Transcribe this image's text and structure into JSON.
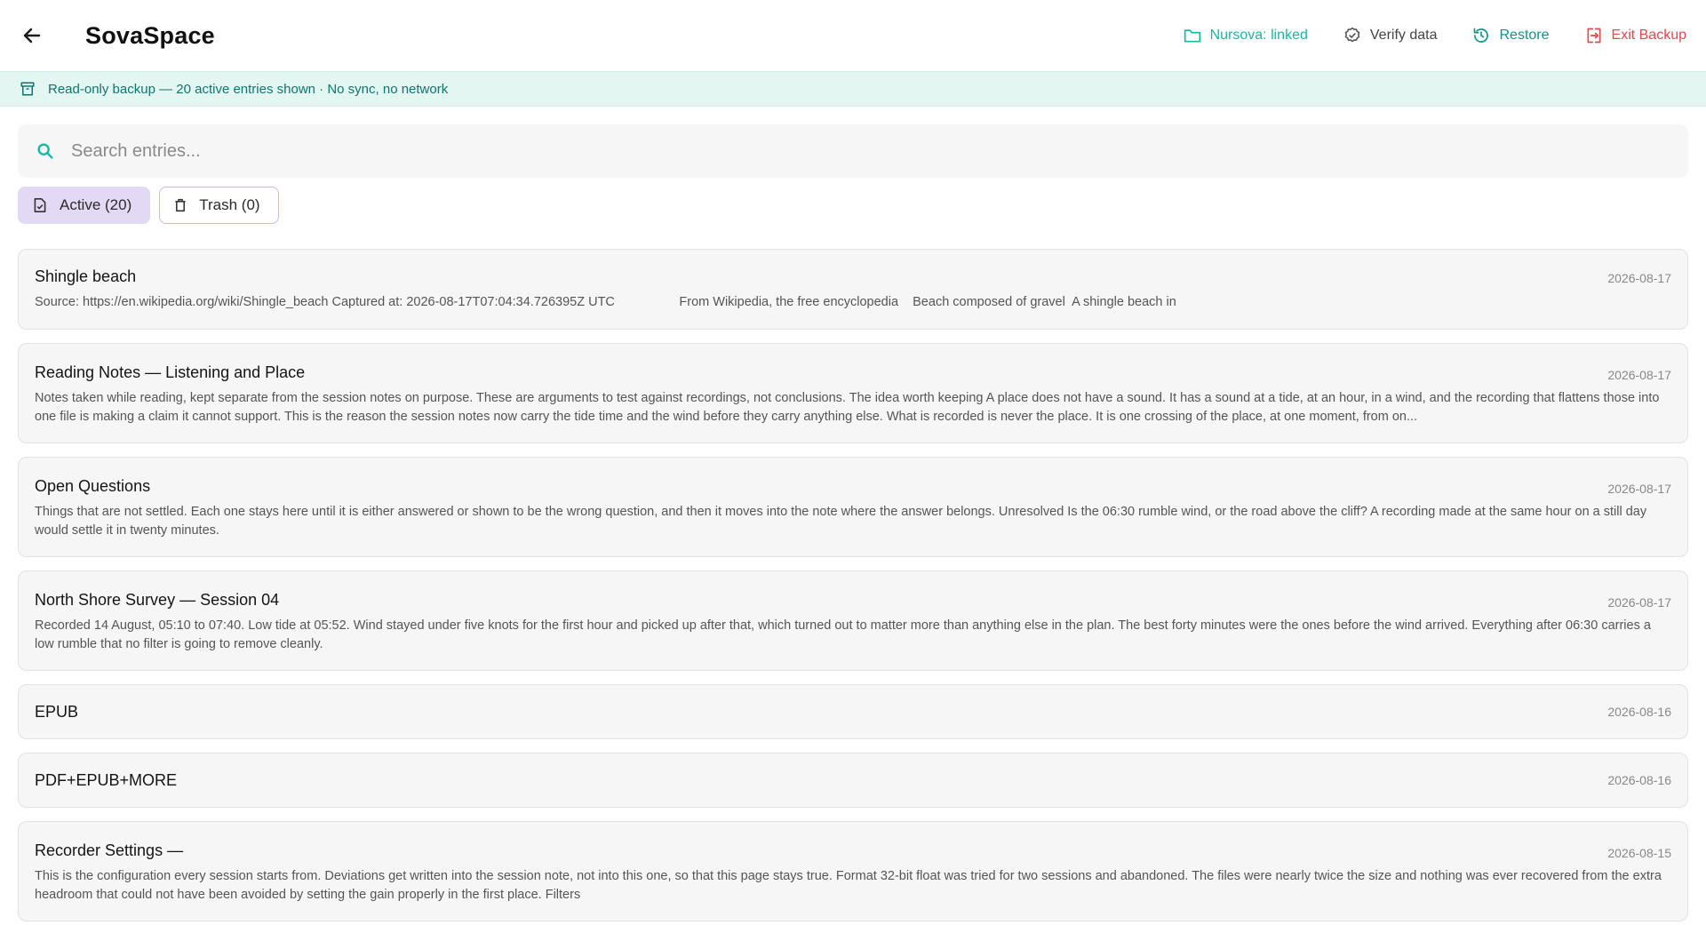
{
  "header": {
    "title": "SovaSpace",
    "actions": {
      "linked_label": "Nursova: linked",
      "verify_label": "Verify data",
      "restore_label": "Restore",
      "exit_label": "Exit Backup"
    }
  },
  "banner": {
    "text": "Read-only backup — 20 active entries shown · No sync, no network"
  },
  "search": {
    "placeholder": "Search entries..."
  },
  "tabs": [
    {
      "label": "Active (20)",
      "icon": "document-icon"
    },
    {
      "label": "Trash (0)",
      "icon": "trash-icon"
    }
  ],
  "colors": {
    "accent": "#14b8a6",
    "restore": "#0f9488",
    "exit": "#e5484d",
    "banner_bg": "#e3f6f1",
    "active_tab_bg": "#e4d9f4"
  },
  "entries": [
    {
      "title": "Shingle beach",
      "date": "2026-08-17",
      "preview": "Source: https://en.wikipedia.org/wiki/Shingle_beach Captured at: 2026-08-17T07:04:34.726395Z UTC                  From Wikipedia, the free encyclopedia    Beach composed of gravel  A shingle beach in"
    },
    {
      "title": "Reading Notes — Listening and Place",
      "date": "2026-08-17",
      "preview": "Notes taken while reading, kept separate from the session notes on purpose. These are arguments to test against recordings, not conclusions. The idea worth keeping A place does not have a sound. It has a sound at a tide, at an hour, in a wind, and the recording that flattens those into one file is making a claim it cannot support. This is the reason the session notes now carry the tide time and the wind before they carry anything else. What is recorded is never the place. It is one crossing of the place, at one moment, from on..."
    },
    {
      "title": "Open Questions",
      "date": "2026-08-17",
      "preview": "Things that are not settled. Each one stays here until it is either answered or shown to be the wrong question, and then it moves into the note where the answer belongs. Unresolved Is the 06:30 rumble wind, or the road above the cliff? A recording made at the same hour on a still day would settle it in twenty minutes."
    },
    {
      "title": "North Shore Survey — Session 04",
      "date": "2026-08-17",
      "preview": "Recorded 14 August, 05:10 to 07:40. Low tide at 05:52. Wind stayed under five knots for the first hour and picked up after that, which turned out to matter more than anything else in the plan. The best forty minutes were the ones before the wind arrived. Everything after 06:30 carries a low rumble that no filter is going to remove cleanly."
    },
    {
      "title": "EPUB",
      "date": "2026-08-16",
      "preview": ""
    },
    {
      "title": "PDF+EPUB+MORE",
      "date": "2026-08-16",
      "preview": ""
    },
    {
      "title": "Recorder Settings —",
      "date": "2026-08-15",
      "preview": "This is the configuration every session starts from. Deviations get written into the session note, not into this one, so that this page stays true. Format   32-bit float was tried for two sessions and abandoned. The files were nearly twice the size and nothing was ever recovered from the extra headroom that could not have been avoided by setting the gain properly in the first place. Filters"
    }
  ]
}
